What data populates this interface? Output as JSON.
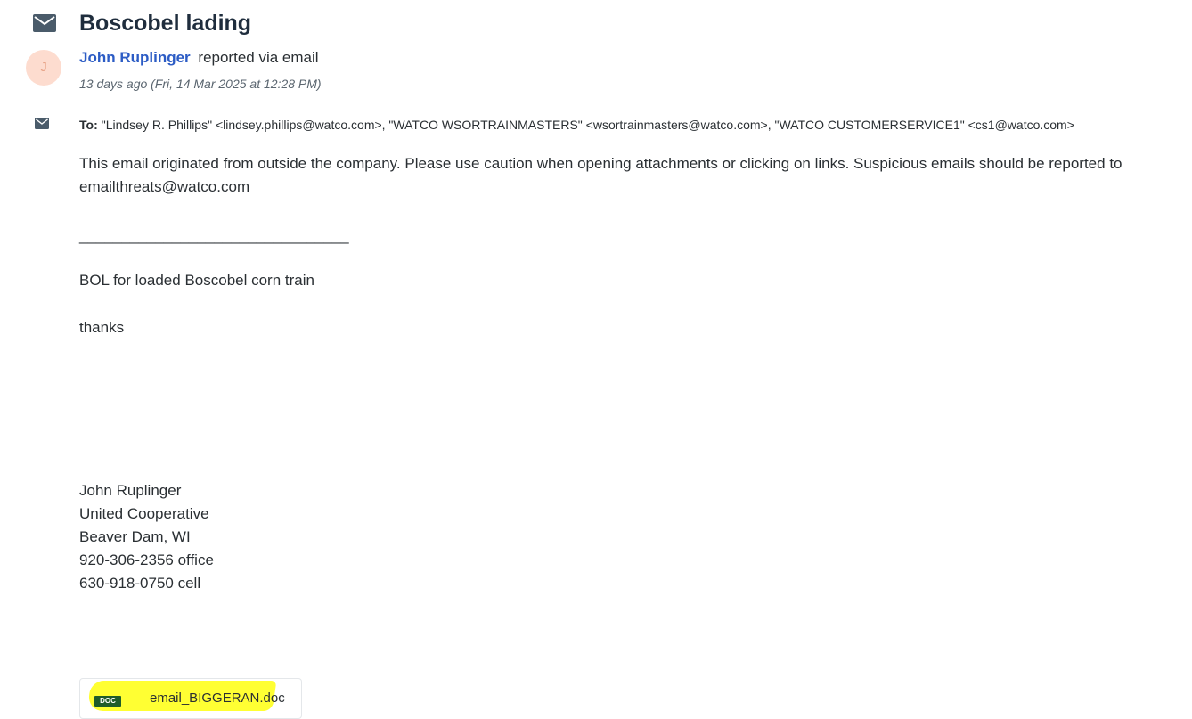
{
  "ticket": {
    "subject": "Boscobel lading",
    "reporter": {
      "name": "John Ruplinger",
      "avatar_initial": "J",
      "via": "reported via email"
    },
    "timestamp": "13 days ago (Fri, 14 Mar 2025 at 12:28 PM)",
    "to_label": "To:",
    "to_recipients": "\"Lindsey R. Phillips\" <lindsey.phillips@watco.com>, \"WATCO WSORTRAINMASTERS\" <wsortrainmasters@watco.com>, \"WATCO CUSTOMERSERVICE1\" <cs1@watco.com>"
  },
  "body": {
    "warning": "This email originated from outside the company. Please use caution when opening attachments or clicking on links. Suspicious emails should be reported to emailthreats@watco.com",
    "separator": "________________________________",
    "message": "BOL for loaded Boscobel corn train",
    "closing": "thanks",
    "signature": {
      "name": "John Ruplinger",
      "company": "United Cooperative",
      "location": "Beaver Dam, WI",
      "office": "920-306-2356 office",
      "cell": "630-918-0750 cell"
    }
  },
  "attachment": {
    "type_badge": "DOC",
    "filename": "email_BIGGERAN.doc"
  },
  "icons": {
    "ticket": "mail-envelope-icon",
    "to": "mail-envelope-icon"
  },
  "colors": {
    "link": "#2c5cc5",
    "avatar_bg": "#fddccf",
    "highlight": "#ffff33",
    "doc_badge": "#1f5c2a"
  }
}
